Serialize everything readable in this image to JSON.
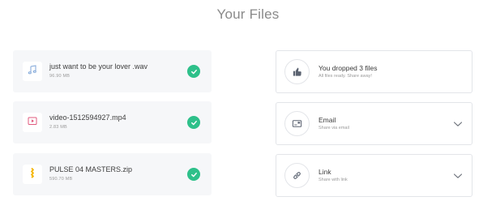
{
  "page": {
    "title": "Your Files"
  },
  "files": [
    {
      "name": "just want to be your lover .wav",
      "size": "96.90 MB",
      "icon": "music-note-icon",
      "status": "done"
    },
    {
      "name": "video-1512594927.mp4",
      "size": "2.83 MB",
      "icon": "video-file-icon",
      "status": "done"
    },
    {
      "name": "PULSE 04 MASTERS.zip",
      "size": "590.70 MB",
      "icon": "zip-file-icon",
      "status": "done"
    }
  ],
  "actions": [
    {
      "title": "You dropped 3 files",
      "subtitle": "All files ready. Share away!",
      "icon": "thumbs-up-icon",
      "expandable": false
    },
    {
      "title": "Email",
      "subtitle": "Share via email",
      "icon": "email-icon",
      "expandable": true
    },
    {
      "title": "Link",
      "subtitle": "Share with link",
      "icon": "link-icon",
      "expandable": true
    }
  ],
  "colors": {
    "accent_green": "#2ec08a",
    "music_icon": "#7fa6d8",
    "video_icon": "#e0587e",
    "zip_icon": "#f4b400",
    "icon_dark": "#5a6270"
  }
}
